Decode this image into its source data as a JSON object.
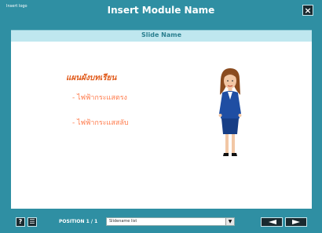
{
  "header": {
    "logo_text": "Insert logo",
    "title": "Insert Module Name",
    "close_label": "×"
  },
  "slide": {
    "name": "Slide Name",
    "heading": "แผนผังบทเรียน",
    "bullets": [
      "- ไฟฟ้ากระแสตรง",
      "- ไฟฟ้ากระแสสลับ"
    ]
  },
  "footer": {
    "help_label": "?",
    "notes_label": "☰",
    "position_text": "POSITION 1 / 1",
    "select_value": "Slidename list",
    "select_arrow": "▼"
  },
  "colors": {
    "frame": "#2f8fa3",
    "slide_bar": "#bfe7ef",
    "heading": "#e05a1a",
    "bullet": "#ff7a4a"
  },
  "icons": {
    "close": "close-icon",
    "help": "help-icon",
    "notes": "notes-icon",
    "prev": "arrow-left-icon",
    "next": "arrow-right-icon",
    "dropdown": "chevron-down-icon"
  }
}
